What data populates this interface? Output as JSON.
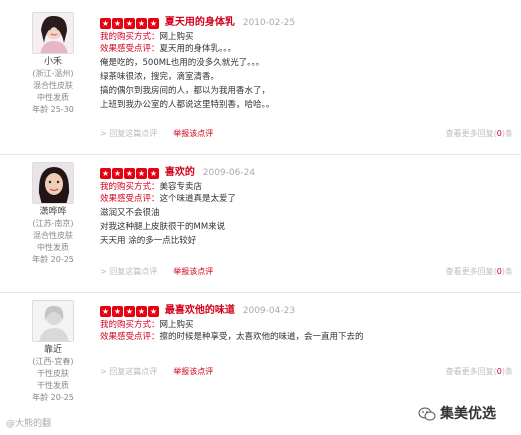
{
  "reviews": [
    {
      "username": "小禾",
      "meta": [
        "(浙江-温州)",
        "混合性皮肤",
        "中性发质",
        "年龄 25-30"
      ],
      "title": "夏天用的身体乳",
      "date": "2010-02-25",
      "buy_label": "我的购买方式：",
      "buy_value": "网上购买",
      "effect_label": "效果感受点评：",
      "effect_value": "夏天用的身体乳。。。",
      "body": [
        "俺是吃的，500ML也用的没多久就光了。。。",
        "绿茶味很浓，搜完，滴室清香。",
        "搞的偶尔到我房间的人，都以为我用香水了，",
        "上班到我办公室的人都说这里特别香，哈哈。。"
      ],
      "reply": "> 回复这篇点评",
      "report": "举报该点评",
      "more_prefix": "查看更多回复(",
      "more_count": "0",
      "more_suffix": ")条"
    },
    {
      "username": "潇哗哗",
      "meta": [
        "(江苏-南京)",
        "混合性皮肤",
        "中性发质",
        "年龄 20-25"
      ],
      "title": "喜欢的",
      "date": "2009-06-24",
      "buy_label": "我的购买方式：",
      "buy_value": "美容专卖店",
      "effect_label": "效果感受点评：",
      "effect_value": "这个味道真是太爱了",
      "body": [
        "滋润又不会很油",
        "对我这种腿上皮肤很干的MM来说",
        "天天用 涂的多一点比较好"
      ],
      "reply": "> 回复这篇点评",
      "report": "举报该点评",
      "more_prefix": "查看更多回复(",
      "more_count": "0",
      "more_suffix": ")条"
    },
    {
      "username": "靠近",
      "meta": [
        "(江西-宜春)",
        "干性皮肤",
        "干性发质",
        "年龄 20-25"
      ],
      "title": "最喜欢他的味道",
      "date": "2009-04-23",
      "buy_label": "我的购买方式：",
      "buy_value": "网上购买",
      "effect_label": "效果感受点评：",
      "effect_value": "擦的时候是种享受，太喜欢他的味道，会一直用下去的",
      "body": [],
      "reply": "> 回复这篇点评",
      "report": "举报该点评",
      "more_prefix": "查看更多回复(",
      "more_count": "0",
      "more_suffix": ")条"
    }
  ],
  "footer": {
    "weibo": "@大熊的翻",
    "account": "集美优选"
  },
  "colors": {
    "accent": "#d3001b",
    "star": "#e60012",
    "muted": "#aaaaaa"
  }
}
